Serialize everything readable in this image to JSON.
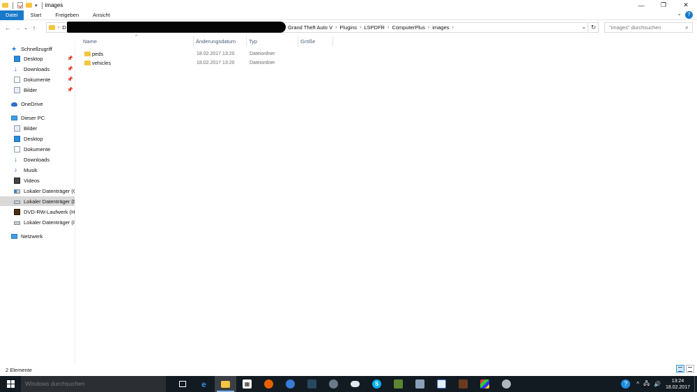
{
  "window": {
    "title": "images",
    "controls": {
      "minimize": "—",
      "maximize": "❐",
      "close": "✕"
    }
  },
  "ribbon": {
    "tabs": [
      {
        "label": "Datei"
      },
      {
        "label": "Start"
      },
      {
        "label": "Freigeben"
      },
      {
        "label": "Ansicht"
      }
    ],
    "help": "?"
  },
  "address": {
    "first_segment": "D",
    "crumbs": [
      "Grand Theft Auto V",
      "Plugins",
      "LSPDFR",
      "ComputerPlus",
      "images"
    ],
    "search_placeholder": "\"images\" durchsuchen"
  },
  "nav": {
    "quick_access": "Schnellzugriff",
    "quick_items": [
      {
        "label": "Desktop",
        "pinned": true
      },
      {
        "label": "Downloads",
        "pinned": true
      },
      {
        "label": "Dokumente",
        "pinned": true
      },
      {
        "label": "Bilder",
        "pinned": true
      }
    ],
    "onedrive": "OneDrive",
    "this_pc": "Dieser PC",
    "pc_items": [
      {
        "label": "Bilder",
        "icon": "pictures-icon"
      },
      {
        "label": "Desktop",
        "icon": "desktop-icon"
      },
      {
        "label": "Dokumente",
        "icon": "documents-icon"
      },
      {
        "label": "Downloads",
        "icon": "download-icon"
      },
      {
        "label": "Musik",
        "icon": "music-icon"
      },
      {
        "label": "Videos",
        "icon": "video-icon"
      },
      {
        "label": "Lokaler Datenträger (C",
        "icon": "drive-c-icon"
      },
      {
        "label": "Lokaler Datenträger (D",
        "icon": "drive-icon",
        "selected": true
      },
      {
        "label": "DVD-RW-Laufwerk (H:",
        "icon": "dvd-icon"
      },
      {
        "label": "Lokaler Datenträger (I:",
        "icon": "drive-icon"
      }
    ],
    "network": "Netzwerk"
  },
  "columns": {
    "name": "Name",
    "date": "Änderungsdatum",
    "type": "Typ",
    "size": "Größe"
  },
  "files": [
    {
      "name": "peds",
      "date": "18.02.2017 13:20",
      "type": "Dateiordner",
      "size": ""
    },
    {
      "name": "vehicles",
      "date": "18.02.2017 13:20",
      "type": "Dateiordner",
      "size": ""
    }
  ],
  "status": {
    "count": "2 Elemente"
  },
  "taskbar": {
    "search_placeholder": "Windows durchsuchen",
    "apps": [
      "task-view-icon",
      "edge-icon",
      "file-explorer-icon",
      "store-icon",
      "firefox-icon",
      "app-icon",
      "steam-icon",
      "app-icon",
      "cloud-icon",
      "skype-icon",
      "minecraft-icon",
      "app-icon",
      "app-icon",
      "app-icon",
      "app-icon",
      "app-icon"
    ],
    "time": "13:24",
    "date": "18.02.2017"
  }
}
